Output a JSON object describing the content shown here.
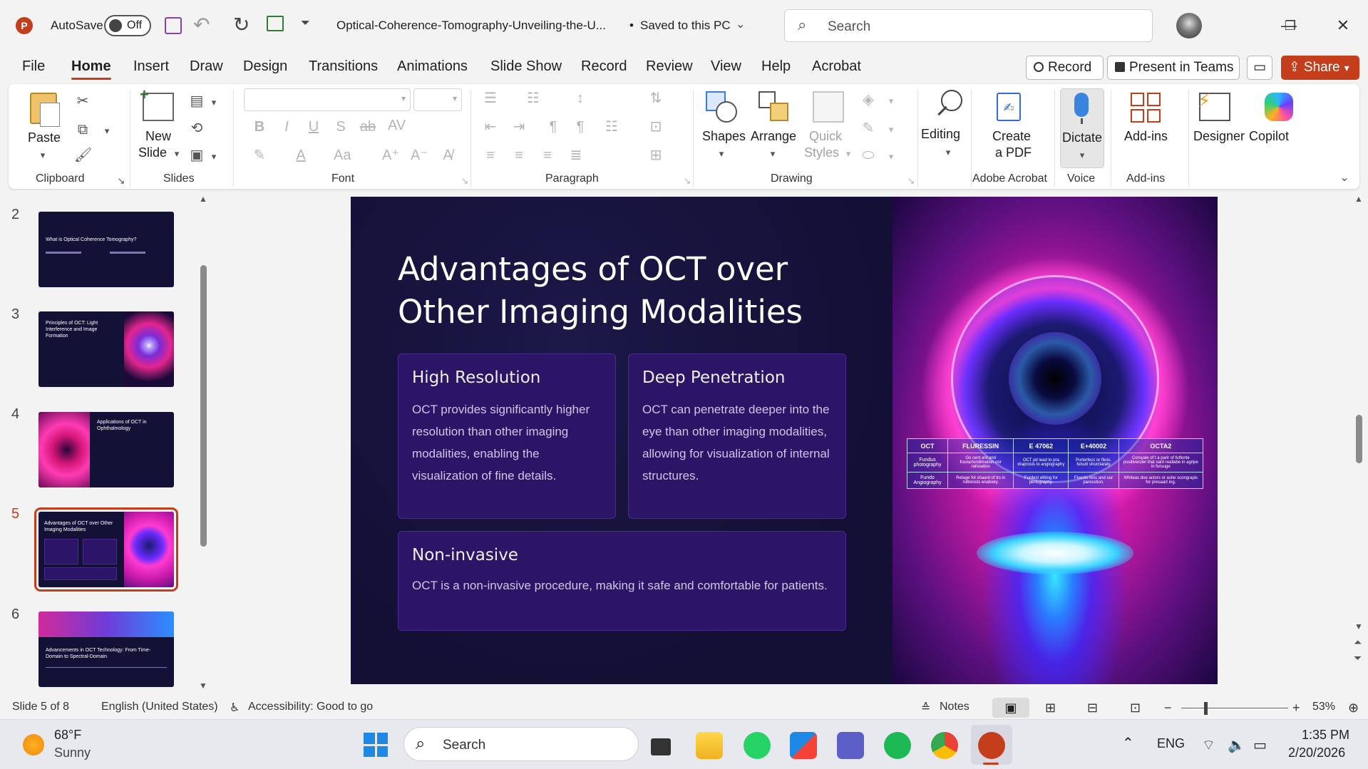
{
  "titlebar": {
    "autosave_label": "AutoSave",
    "autosave_state": "Off",
    "doc_title": "Optical-Coherence-Tomography-Unveiling-the-U...",
    "save_status": "Saved to this PC",
    "search_placeholder": "Search"
  },
  "menu": {
    "tabs": [
      "File",
      "Home",
      "Insert",
      "Draw",
      "Design",
      "Transitions",
      "Animations",
      "Slide Show",
      "Record",
      "Review",
      "View",
      "Help",
      "Acrobat"
    ],
    "active": "Home",
    "record_btn": "Record",
    "teams_btn": "Present in Teams",
    "share_btn": "Share"
  },
  "ribbon": {
    "paste": "Paste",
    "new_slide_1": "New",
    "new_slide_2": "Slide",
    "shapes": "Shapes",
    "arrange": "Arrange",
    "quick_styles_1": "Quick",
    "quick_styles_2": "Styles",
    "editing": "Editing",
    "create_pdf_1": "Create",
    "create_pdf_2": "a PDF",
    "dictate": "Dictate",
    "addins": "Add-ins",
    "designer": "Designer",
    "copilot": "Copilot",
    "groups": {
      "clipboard": "Clipboard",
      "slides": "Slides",
      "font": "Font",
      "paragraph": "Paragraph",
      "drawing": "Drawing",
      "adobe": "Adobe Acrobat",
      "voice": "Voice",
      "addins": "Add-ins"
    }
  },
  "thumbnails": [
    {
      "num": "2",
      "title": "What is Optical Coherence Tomography?"
    },
    {
      "num": "3",
      "title": "Principles of OCT: Light Interference and Image Formation"
    },
    {
      "num": "4",
      "title": "Applications of OCT in Ophthalmology"
    },
    {
      "num": "5",
      "title": "Advantages of OCT over Other Imaging Modalities"
    },
    {
      "num": "6",
      "title": "Advancements in OCT Technology: From Time-Domain to Spectral-Domain"
    }
  ],
  "slide": {
    "title": "Advantages of OCT over Other Imaging Modalities",
    "cards": [
      {
        "heading": "High Resolution",
        "text": "OCT provides significantly higher resolution than other imaging modalities, enabling the visualization of fine details."
      },
      {
        "heading": "Deep Penetration",
        "text": "OCT can penetrate deeper into the eye than other imaging modalities, allowing for visualization of internal structures."
      },
      {
        "heading": "Non-invasive",
        "text": "OCT is a non-invasive procedure, making it safe and comfortable for patients."
      }
    ],
    "table": {
      "headers": [
        "OCT",
        "FLURESSIN",
        "E 47062",
        "E+40002",
        "OCTA2"
      ],
      "rows": [
        [
          "Fundus photography",
          "Go cent ant and frastartorollmation oor rafosation",
          "OCT pd lead to pra draprosis to angiography",
          "Purterfecc or flexs. fulsutt shurctaraty",
          "Corsyale of t a parir of futfonte positiveruler that oant reallabe in agripe in furuuge"
        ],
        [
          "Fundo Angiography",
          "Retage fot shaard of trs in rultrensts enabiety.",
          "Furdest ething for pertography.",
          "Fluerits lens and our paresstion.",
          "Whiteas doe actors or ashe scongrapis for presaart ing."
        ]
      ]
    }
  },
  "statusbar": {
    "slide_of": "Slide 5 of 8",
    "language": "English (United States)",
    "accessibility": "Accessibility: Good to go",
    "notes": "Notes",
    "zoom": "53%"
  },
  "taskbar": {
    "temp": "68°F",
    "weather": "Sunny",
    "search": "Search",
    "lang": "ENG",
    "time": "1:35 PM",
    "date": "2/20/2026"
  }
}
